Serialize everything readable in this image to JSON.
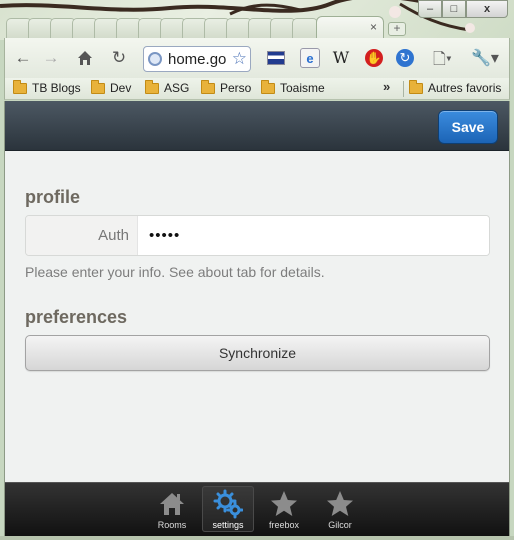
{
  "browser": {
    "address": "home.go",
    "bookmarks": [
      "TB Blogs",
      "Dev",
      "ASG",
      "Perso",
      "Toaisme"
    ],
    "bookmarks_overflow": "»",
    "other_bookmarks": "Autres favoris",
    "window_controls": {
      "minimize": "–",
      "maximize": "□",
      "close": "x"
    },
    "tab_close": "×",
    "new_tab": "+",
    "extension_wiki": "W"
  },
  "header": {
    "save_label": "Save"
  },
  "profile": {
    "title": "profile",
    "auth_label": "Auth",
    "auth_value": "•••••",
    "help_text": "Please enter your info. See about tab for details."
  },
  "preferences": {
    "title": "preferences",
    "sync_label": "Synchronize"
  },
  "tabbar": {
    "items": [
      {
        "label": "Rooms",
        "icon": "home-icon",
        "active": false
      },
      {
        "label": "settings",
        "icon": "gears-icon",
        "active": true
      },
      {
        "label": "freebox",
        "icon": "star-icon",
        "active": false
      },
      {
        "label": "Gilcor",
        "icon": "star-icon",
        "active": false
      }
    ]
  },
  "colors": {
    "header_bg": "#2b343c",
    "save_button": "#1c64b6",
    "active_icon": "#3a8fdc",
    "section_title": "#6e6960"
  }
}
